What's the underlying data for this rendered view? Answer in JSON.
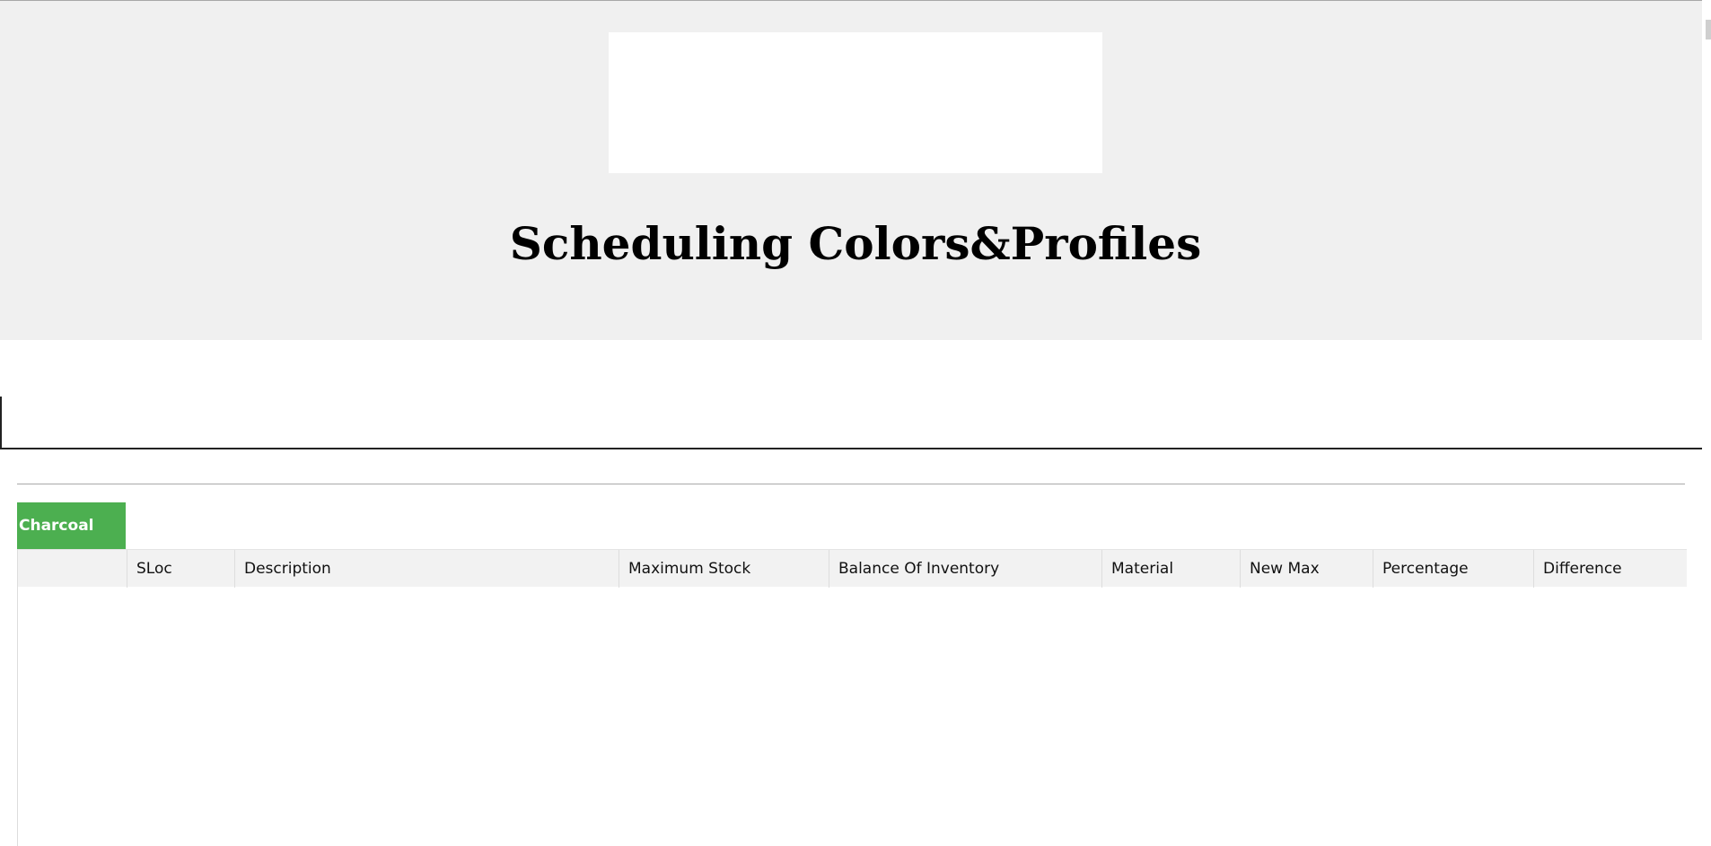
{
  "header": {
    "title": "Scheduling Colors&Profiles"
  },
  "tabs": [
    {
      "label": "Charcoal",
      "color": "#4caf50"
    }
  ],
  "table": {
    "columns": [
      "",
      "SLoc",
      "Description",
      "Maximum Stock",
      "Balance Of Inventory",
      "Material",
      "New Max",
      "Percentage",
      "Difference"
    ],
    "rows": []
  }
}
